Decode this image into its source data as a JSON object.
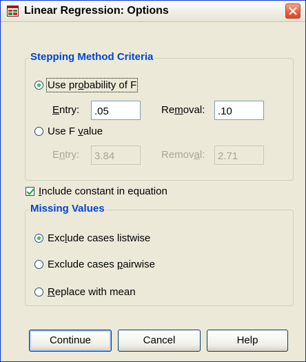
{
  "window": {
    "title": "Linear Regression: Options",
    "close_glyph": "✕"
  },
  "stepping": {
    "legend": "Stepping Method Criteria",
    "use_probability": {
      "pre": "Use pr",
      "mnemonic": "o",
      "post": "bability of F",
      "checked": true
    },
    "prob_entry": {
      "mnemonic": "E",
      "post": "ntry:",
      "value": ".05"
    },
    "prob_removal": {
      "pre": "Re",
      "mnemonic": "m",
      "post": "oval:",
      "value": ".10"
    },
    "use_f_value": {
      "pre": "Use F ",
      "mnemonic": "v",
      "post": "alue",
      "checked": false
    },
    "f_entry": {
      "pre": "E",
      "mnemonic": "n",
      "post": "try:",
      "value": "3.84"
    },
    "f_removal": {
      "pre": "Remov",
      "mnemonic": "a",
      "post": "l:",
      "value": "2.71"
    }
  },
  "include_constant": {
    "mnemonic": "I",
    "post": "nclude constant in equation",
    "checked": true
  },
  "missing": {
    "legend": "Missing Values",
    "listwise": {
      "pre": "Exc",
      "mnemonic": "l",
      "post": "ude cases listwise",
      "checked": true
    },
    "pairwise": {
      "pre": "Exclude cases ",
      "mnemonic": "p",
      "post": "airwise",
      "checked": false
    },
    "replace_mean": {
      "mnemonic": "R",
      "post": "eplace with mean",
      "checked": false
    }
  },
  "buttons": {
    "continue": "Continue",
    "cancel": "Cancel",
    "help": "Help"
  },
  "colors": {
    "legend": "#0046d5",
    "disabled_text": "#a7a698",
    "dialog_bg": "#ece9d8"
  }
}
